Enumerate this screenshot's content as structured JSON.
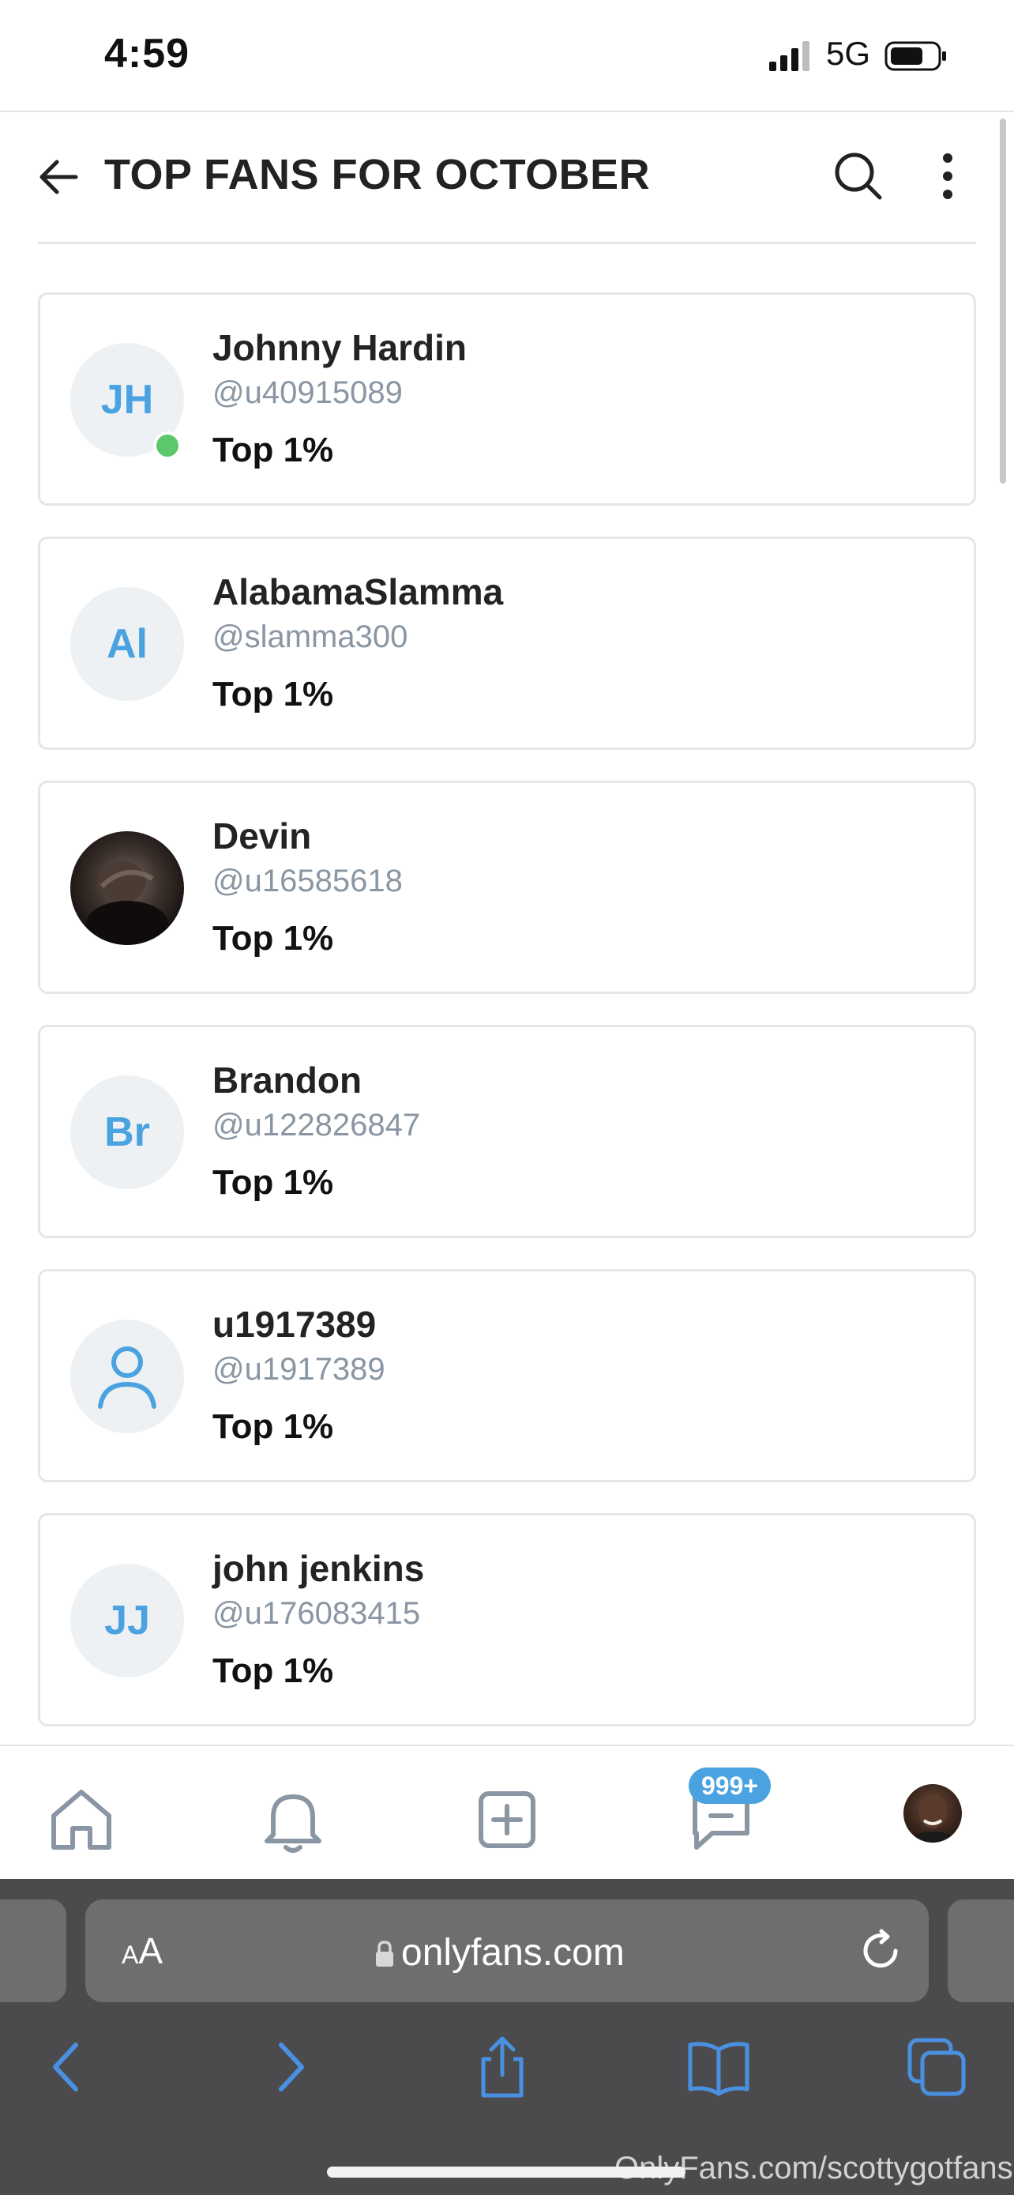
{
  "status_bar": {
    "time": "4:59",
    "network": "5G"
  },
  "header": {
    "title": "TOP FANS FOR OCTOBER"
  },
  "fans": [
    {
      "initials": "JH",
      "name": "Johnny Hardin",
      "handle": "@u40915089",
      "rank": "Top 1%",
      "online": true
    },
    {
      "initials": "Al",
      "name": "AlabamaSlamma",
      "handle": "@slamma300",
      "rank": "Top 1%"
    },
    {
      "initials": "",
      "name": "Devin",
      "handle": "@u16585618",
      "rank": "Top 1%",
      "photo": true
    },
    {
      "initials": "Br",
      "name": "Brandon",
      "handle": "@u122826847",
      "rank": "Top 1%"
    },
    {
      "initials": "",
      "name": "u1917389",
      "handle": "@u1917389",
      "rank": "Top 1%",
      "default_icon": "user-icon"
    },
    {
      "initials": "JJ",
      "name": "john jenkins",
      "handle": "@u176083415",
      "rank": "Top 1%"
    }
  ],
  "bottom_nav": {
    "items": [
      "home-icon",
      "bell-icon",
      "add-post-icon",
      "messages-icon",
      "profile-avatar"
    ],
    "messages_badge": "999+"
  },
  "browser": {
    "aa_label_small": "A",
    "aa_label_large": "A",
    "url": "onlyfans.com",
    "watermark": "OnlyFans.com/scottygotfans"
  },
  "colors": {
    "accent": "#4aa3e0",
    "online": "#5bc86b",
    "handle_gray": "#8a96a3",
    "browser_chrome": "#4b4b4d"
  }
}
